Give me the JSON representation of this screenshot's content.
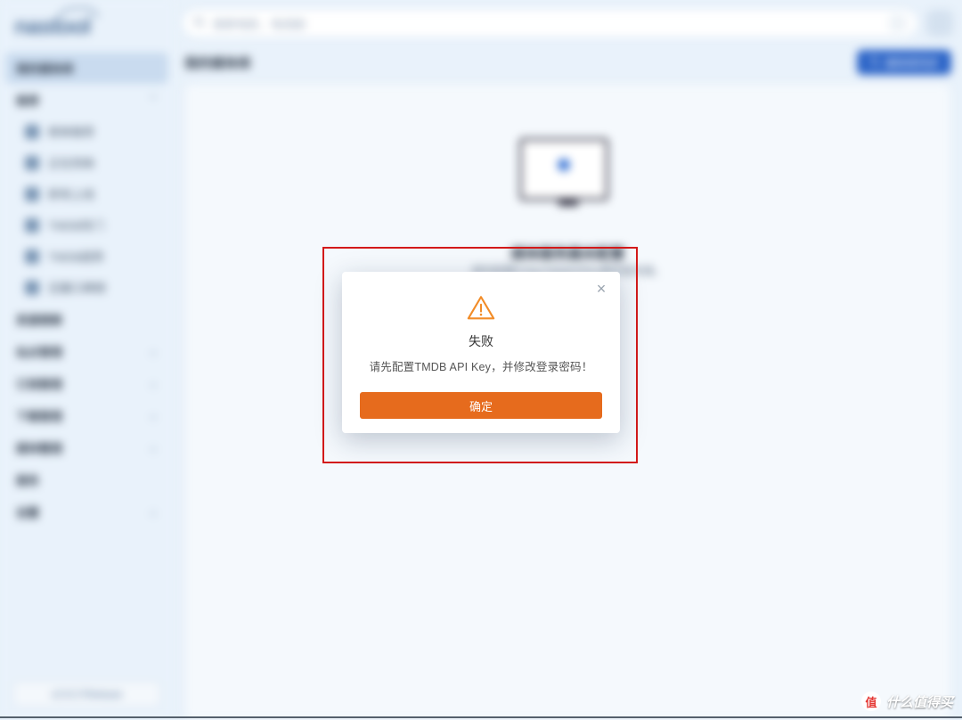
{
  "logo": "nastool",
  "search": {
    "placeholder": "搜索电影、电视剧"
  },
  "sidebar": {
    "active": "我的媒体库",
    "group1": {
      "title": "推荐",
      "items": [
        "榜单推荐",
        "正在热映",
        "即将上线",
        "TMDB热门",
        "TMDB趋势",
        "豆瓣口碑榜"
      ]
    },
    "plain": [
      "资源搜索"
    ],
    "collapsible": [
      "站点管理",
      "订阅管理",
      "下载管理",
      "媒体整理"
    ],
    "plain2": [
      "服务"
    ],
    "collapsible2": [
      "设置"
    ],
    "footer": "v2.8.3 Release"
  },
  "page": {
    "title": "我的媒体库",
    "action": "媒体库同步",
    "emptyTitle": "媒体服务器未配置",
    "emptySub": "请先配置Emby/Jellyfin/Plex媒体服务器。"
  },
  "modal": {
    "title": "失败",
    "message": "请先配置TMDB API Key，并修改登录密码！",
    "ok": "确定"
  },
  "watermark": {
    "badge": "值",
    "text": "什么值得买"
  }
}
